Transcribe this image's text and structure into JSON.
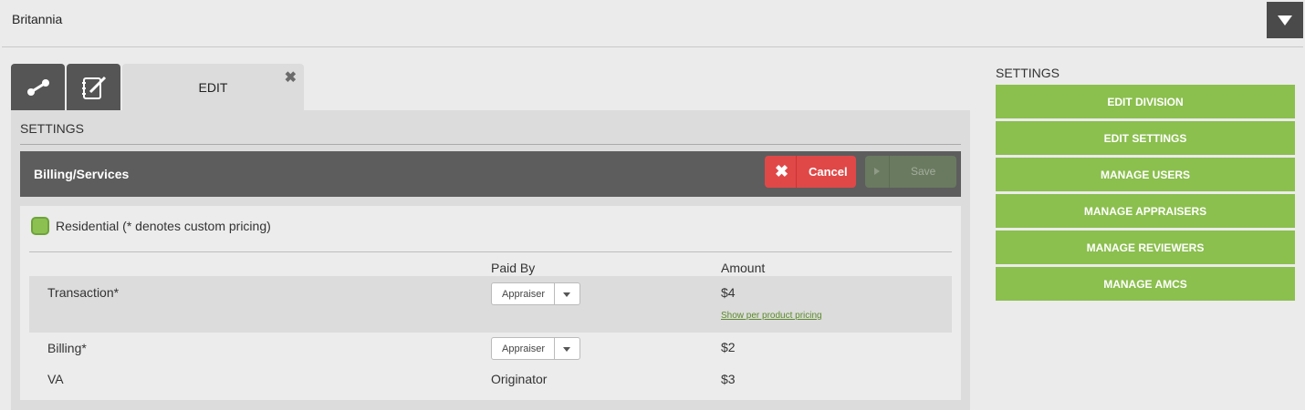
{
  "header": {
    "org_name": "Britannia",
    "dropdown_icon": "caret-down-icon"
  },
  "tabs": {
    "icons": [
      "link-icon",
      "edit-notes-icon"
    ],
    "active_label": "EDIT",
    "close_icon": "close-icon"
  },
  "panel": {
    "settings_heading": "SETTINGS",
    "bar_title": "Billing/Services",
    "cancel_label": "Cancel",
    "save_label": "Save"
  },
  "section": {
    "title": "Residential (* denotes custom pricing)",
    "checked": true,
    "columns": {
      "paid_by": "Paid By",
      "amount": "Amount"
    },
    "rows": [
      {
        "name": "Transaction*",
        "paid_by": "Appraiser",
        "amount": "$4",
        "link": "Show per product pricing"
      },
      {
        "name": "Billing*",
        "paid_by": "Appraiser",
        "amount": "$2"
      },
      {
        "name": "VA",
        "paid_by": "Originator",
        "amount": "$3"
      }
    ]
  },
  "sidebar": {
    "heading": "SETTINGS",
    "buttons": [
      "EDIT DIVISION",
      "EDIT SETTINGS",
      "MANAGE USERS",
      "MANAGE APPRAISERS",
      "MANAGE REVIEWERS",
      "MANAGE AMCS"
    ]
  },
  "colors": {
    "accent_green": "#8bbf4e",
    "cancel_red": "#e04848",
    "bar_dark": "#5d5d5d"
  }
}
